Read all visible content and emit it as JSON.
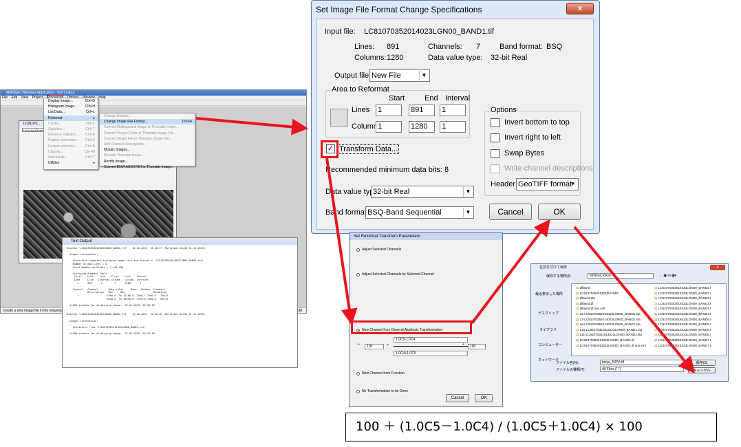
{
  "main_window": {
    "title": "MultiSpec Windows Application - Text Output",
    "menus": [
      "File",
      "Edit",
      "View",
      "Project",
      "Processor",
      "Options",
      "Window",
      "Help"
    ],
    "image_window_title": "LC81070...",
    "image_combo_value": "Lat-Long (Decimal)",
    "status_text": "Create a new image file in the requested format.",
    "status_right": "NUM"
  },
  "processor_menu": [
    {
      "label": "Display Image...",
      "shortcut": "Ctrl+D",
      "state": "normal"
    },
    {
      "label": "Histogram Image...",
      "shortcut": "Ctrl+H",
      "state": "normal"
    },
    {
      "label": "List Data...",
      "shortcut": "Ctrl+L",
      "state": "normal"
    },
    {
      "label": "Reformat",
      "shortcut": "▸",
      "state": "selected"
    },
    {
      "label": "Cluster...",
      "shortcut": "Ctrl+L",
      "state": "gray"
    },
    {
      "label": "Statistics...",
      "shortcut": "Ctrl+T",
      "state": "gray"
    },
    {
      "label": "Enhance statistics...",
      "shortcut": "Ctrl+E",
      "state": "gray"
    },
    {
      "label": "Feature extraction...",
      "shortcut": "Ctrl+X",
      "state": "gray"
    },
    {
      "label": "Feature selection...",
      "shortcut": "Ctrl+B",
      "state": "gray"
    },
    {
      "label": "Classify...",
      "shortcut": "Ctrl+M",
      "state": "gray"
    },
    {
      "label": "List results...",
      "shortcut": "Ctrl+Y",
      "state": "gray"
    },
    {
      "label": "Utilities",
      "shortcut": "▸",
      "state": "normal"
    }
  ],
  "reformat_menu": [
    {
      "label": "Change Header...",
      "shortcut": "",
      "state": "gray"
    },
    {
      "label": "Change Image File Format...",
      "shortcut": "Ctrl+R",
      "state": "selected"
    },
    {
      "label": "Convert Multispectral Image to Thematic Image...",
      "shortcut": "",
      "state": "gray"
    },
    {
      "label": "Convert Project Fields to Thematic Image File...",
      "shortcut": "",
      "state": "gray"
    },
    {
      "label": "Convert Shape File to Thematic Image File...",
      "shortcut": "",
      "state": "gray"
    },
    {
      "label": "Add Channel Descriptions...",
      "shortcut": "",
      "state": "gray"
    },
    {
      "label": "Mosaic Images...",
      "shortcut": "",
      "state": "normal"
    },
    {
      "label": "Recode Thematic Image...",
      "shortcut": "",
      "state": "gray"
    },
    {
      "label": "Rectify Image...",
      "shortcut": "",
      "state": "normal"
    },
    {
      "label": "Convert ENVI ASCII ROI to Thematic Image...",
      "shortcut": "",
      "state": "normal"
    }
  ],
  "text_output": {
    "title": "Text Output",
    "body": "Display 'LC81070352014023LGN00_BAND1.tif'   12-02-2015  16:38:17 (MultiSpec Win32_01.12.2015)\n\n  Output information:\n\n    Statistics computed Histogram image file and stored in 'LC81070352014023LGN00_BAND1.sta'\n    Number of Bad Lines = 0\n    Total Number of Pixels = 1,146,496\n\n    Histogram Summary Table\n     First    Last    Line    First    Last    Column\n     Line     Line   Interval Column   Column  Interval\n       1      891      1        1      1280      1\n\n    Channel   Channel       Data Value     Mean   Median  Standard\n              Description   Min     Max                   Deviation\n       1                   6368.0  To 32766.0  7500.1 7400.0   700.0\n                           6340.0  To 30598.0  7376.0 7300.0   697.8\n\n  0.090 seconds for displaying image.  12-02-2015  16:38:19\n\n\nDisplay 'LC81070352014023LGN00_BAND1.tif'   12-02-2015  16:40:16 (MultiSpec Win32_01.12.2015)\n\n  Output information:\n\n    Statistics from 'LC81070352014023LGN00_BAND1.sta'\n\n  0.090 seconds for displaying image.  12-02-2015  16:40:18"
  },
  "dialog": {
    "title": "Set Image File Format Change Specifications",
    "close_label": "x",
    "input_file_label": "Input file:",
    "input_file": "LC81070352014023LGN00_BAND1.tif",
    "lines_label": "Lines:",
    "lines": "891",
    "channels_label": "Channels:",
    "channels": "7",
    "band_format_label": "Band format:",
    "band_format_value": "BSQ",
    "columns_label": "Columns:",
    "columns": "1280",
    "data_value_type_label": "Data value type:",
    "data_value_type_value": "32-bit Real",
    "output_file_label": "Output file:",
    "output_file": "New File",
    "area_group": "Area to Reformat",
    "start_label": "Start",
    "end_label": "End",
    "interval_label": "Interval",
    "area_lines_label": "Lines",
    "area_columns_label": "Columns",
    "line_start": "1",
    "line_end": "891",
    "line_interval": "1",
    "col_start": "1",
    "col_end": "1280",
    "col_interval": "1",
    "options_group": "Options",
    "invert_bottom": "Invert bottom to top",
    "invert_right": "Invert right to left",
    "swap_bytes": "Swap Bytes",
    "write_channel": "Write channel descriptions",
    "header_label": "Header:",
    "header_value": "GeoTIFF format",
    "transform_label": "Transform Data...",
    "transform_check": "✓",
    "rec_bits": "Recommended minimum data bits: 8",
    "dvt_label": "Data value type:",
    "dvt_value": "32-bit Real",
    "bf_label": "Band format:",
    "bf_value": "BSQ-Band Sequential",
    "cancel": "Cancel",
    "ok": "OK"
  },
  "transform_dialog": {
    "title": "Set Reformat Transform Parameters",
    "opt1": "Adjust Selected Channels",
    "opt2": "Adjust Selected Channels by Selected Channel",
    "opt3": "New Channel from General Algebraic Transformation",
    "numerator": "1.0C5-1.0C4",
    "denominator": "1.0C4+1.0C5",
    "offset": "100",
    "factor": "100",
    "plus1": "+",
    "mult": "×",
    "plus2": "+",
    "opt4": "New Channel from Function",
    "opt5": "No Transformation to be Done",
    "cancel": "Cancel",
    "ok": "OK"
  },
  "save_dialog": {
    "title": "名前を付けて保存",
    "save_in_label": "保存する場所(I):",
    "folder": "landsat_tokyo",
    "sidebar": [
      "最近表示した場所",
      "デスクトップ",
      "ライブラリ",
      "コンピューター",
      "ネットワーク"
    ],
    "files_left": [
      "allband",
      "LC81070352014023LGN00",
      "allband.sta",
      "allband.tif",
      "allband.tif.aux.xml",
      "L2-LC81070352014023LGN00_BAND1.sta",
      "L7-LC81070352014023LGN00_BAND1.sta",
      "L8-LC81070352014023LGN00_BAND1.sta",
      "L10-LC81070352014023LGN00_BAND1.sta",
      "L11-LC81070352014023LGN00_BAND1.sta",
      "LC81070352014023LGN00_BAND1.tif",
      "LC81070352014023LGN00_BAND1.tif.aux.xml"
    ],
    "files_right": [
      "LC81070352014023LGN00_BAND2.t",
      "LC81070352014023LGN00_BAND2.t",
      "LC81070352014023LGN00_BAND3.t",
      "LC81070352014023LGN00_BAND3.t",
      "LC81070352014023LGN00_BAND4.t",
      "LC81070352014023LGN00_BAND4.t",
      "LC81070352014023LGN00_BAND5.t",
      "LC81070352014023LGN00_BAND5.t",
      "LC81070352014023LGN00_BAND6.t",
      "LC81070352014023LGN00_BAND6.t",
      "LC81070352014023LGN00_BAND7.t",
      "LC81070352014023LGN00_BAND7.t"
    ],
    "filename_label": "ファイル名(N):",
    "filename": "tokyo_NDVI.tif",
    "filetype_label": "ファイルの種類(T):",
    "filetype": "All Files (*.*)",
    "save": "保存(S)",
    "cancel": "キャンセル"
  },
  "formula": "100 ＋ (1.0C5－1.0C4) / (1.0C5＋1.0C4) × 100",
  "colors": {
    "highlight": "#e8141e",
    "dialog_frame": "#dde9f7",
    "title_blue": "#3a6dbf"
  }
}
